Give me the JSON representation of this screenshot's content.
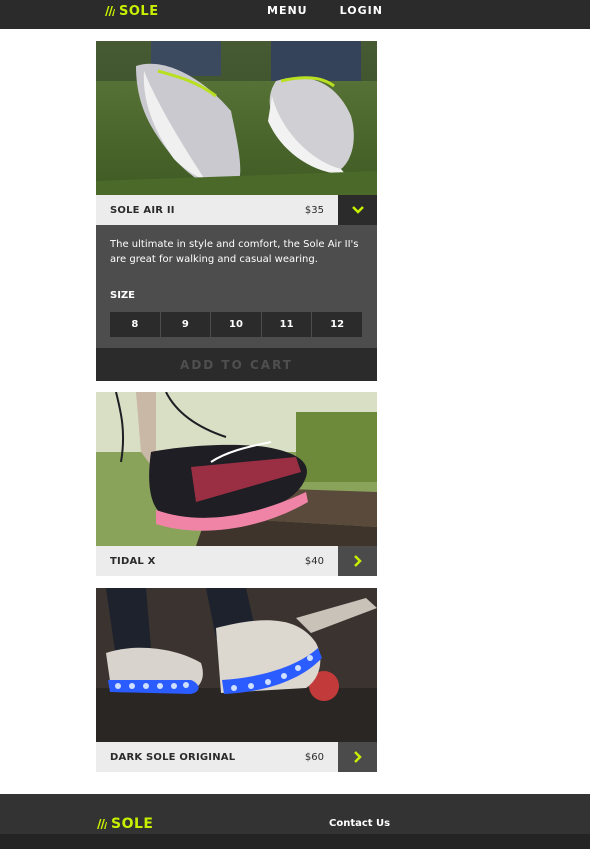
{
  "brand": {
    "name": "SOLE",
    "color": "#c6f000"
  },
  "nav": {
    "menu": "MENU",
    "login": "LOGIN"
  },
  "products": [
    {
      "name": "SOLE AIR II",
      "price": "$35",
      "expanded": true,
      "toggle_icon": "chevron-down-icon",
      "description": "The ultimate in style and comfort, the Sole Air II's are great for walking and casual wearing.",
      "size_label": "SIZE",
      "sizes": [
        "8",
        "9",
        "10",
        "11",
        "12"
      ],
      "cart_label": "ADD TO CART"
    },
    {
      "name": "TIDAL X",
      "price": "$40",
      "expanded": false,
      "toggle_icon": "chevron-right-icon"
    },
    {
      "name": "DARK SOLE ORIGINAL",
      "price": "$60",
      "expanded": false,
      "toggle_icon": "chevron-right-icon"
    }
  ],
  "footer": {
    "contact": "Contact Us"
  }
}
